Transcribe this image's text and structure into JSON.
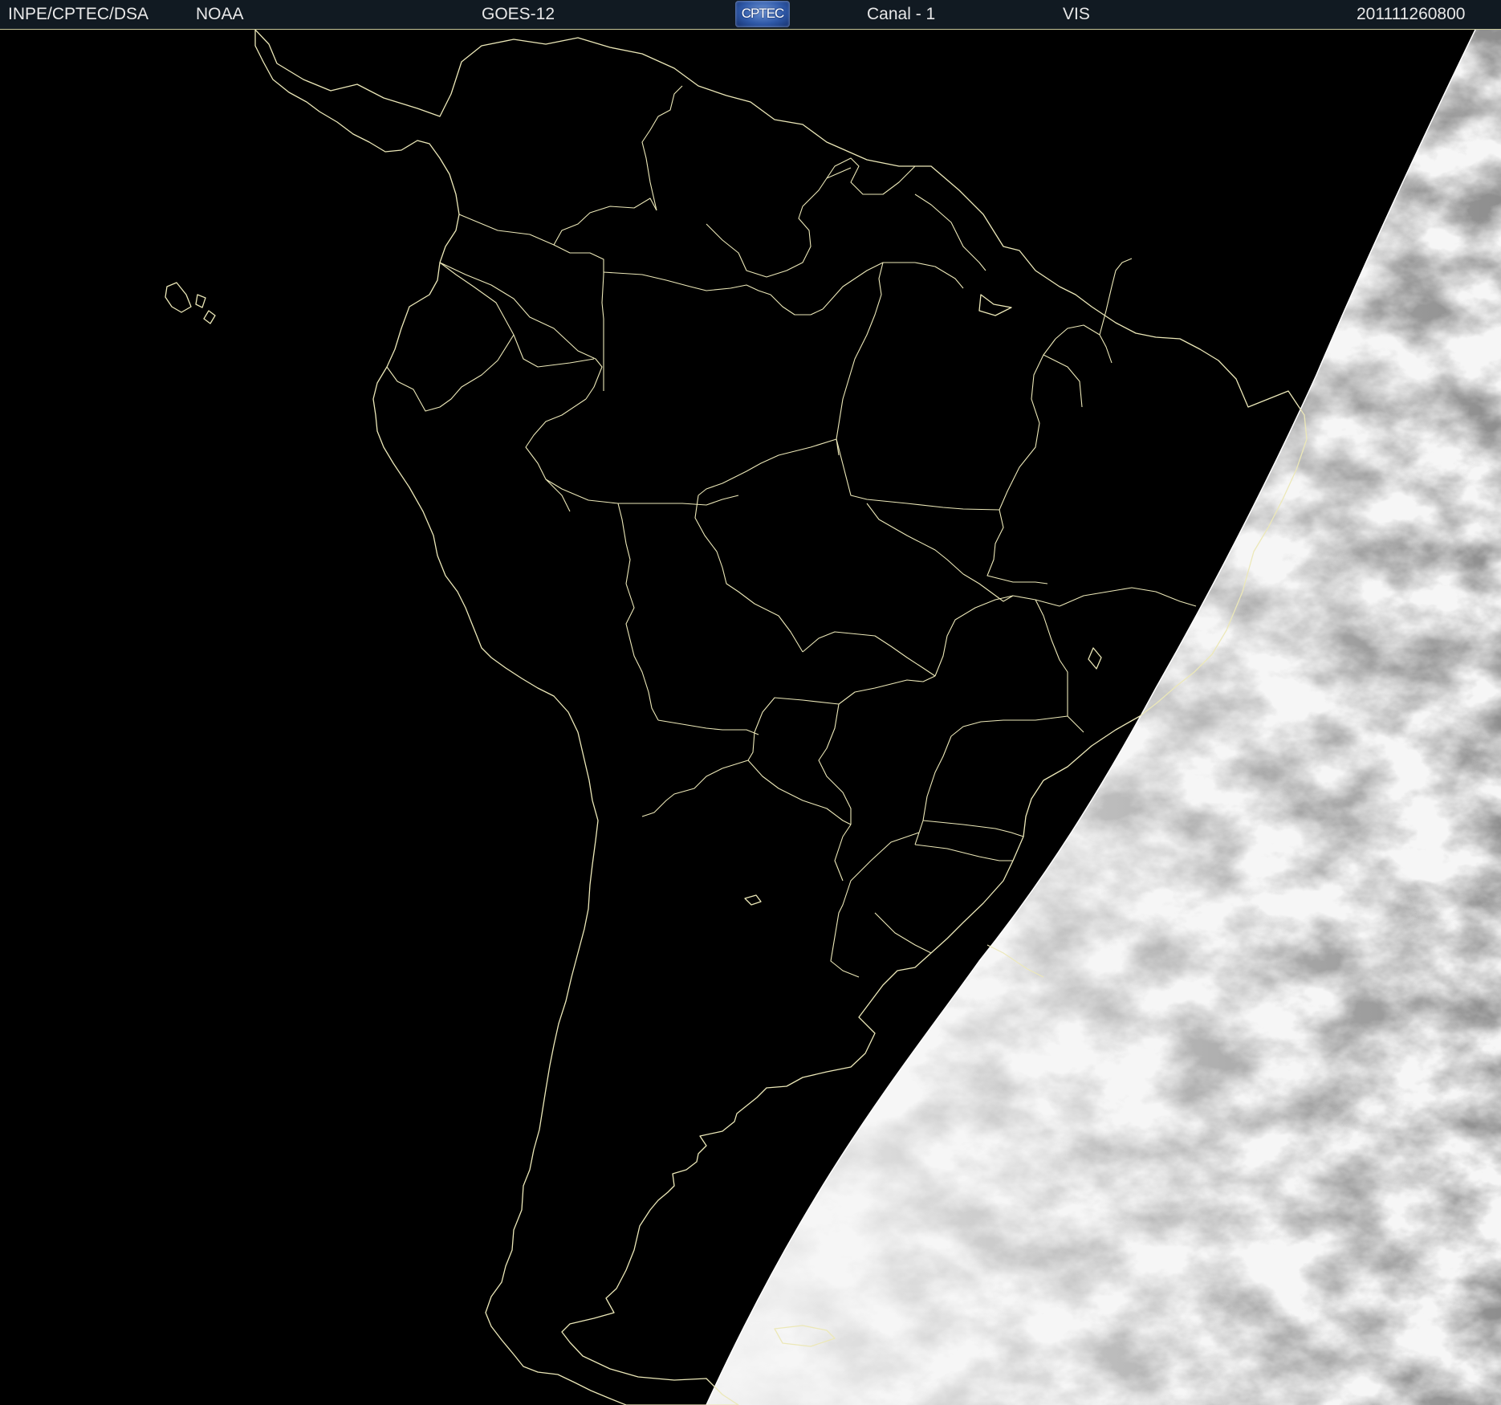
{
  "header": {
    "agency": "INPE/CPTEC/DSA",
    "source": "NOAA",
    "satellite": "GOES-12",
    "logo_text": "CPTEC",
    "channel": "Canal - 1",
    "band": "VIS",
    "timestamp": "201111260800"
  },
  "colors": {
    "background": "#000000",
    "header_bg": "#111a22",
    "outline": "#ece8b8",
    "logo_blue": "#2f59a8"
  },
  "map": {
    "type": "satellite visible-channel image with country and state outlines",
    "region": "South America",
    "illuminated_side": "east"
  }
}
